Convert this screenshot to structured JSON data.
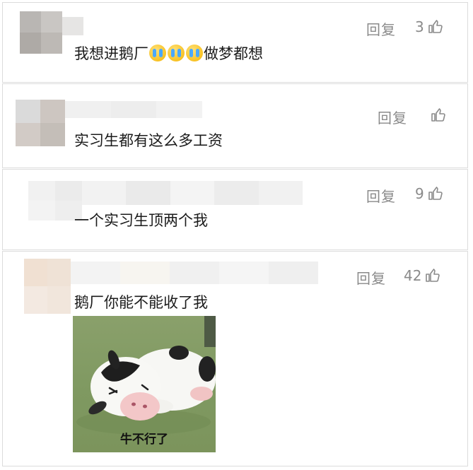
{
  "comments": [
    {
      "text": "我想进鹅厂",
      "text_after": "做梦都想",
      "reply": "回复",
      "likes": "3"
    },
    {
      "text": "实习生都有这么多工资",
      "reply": "回复",
      "likes": ""
    },
    {
      "text": "一个实习生顶两个我",
      "reply": "回复",
      "likes": "9"
    },
    {
      "text": "鹅厂你能不能收了我",
      "reply": "回复",
      "likes": "42"
    }
  ],
  "meme": {
    "caption": "牛不行了",
    "icon": "sleeping-cow"
  },
  "icons": {
    "like": "thumbs-up-icon",
    "emoji": "crying-face-emoji"
  },
  "colors": {
    "meta_text": "#8a8a8a",
    "divider": "#dcdcdc",
    "meme_bg": "#7f9961"
  }
}
